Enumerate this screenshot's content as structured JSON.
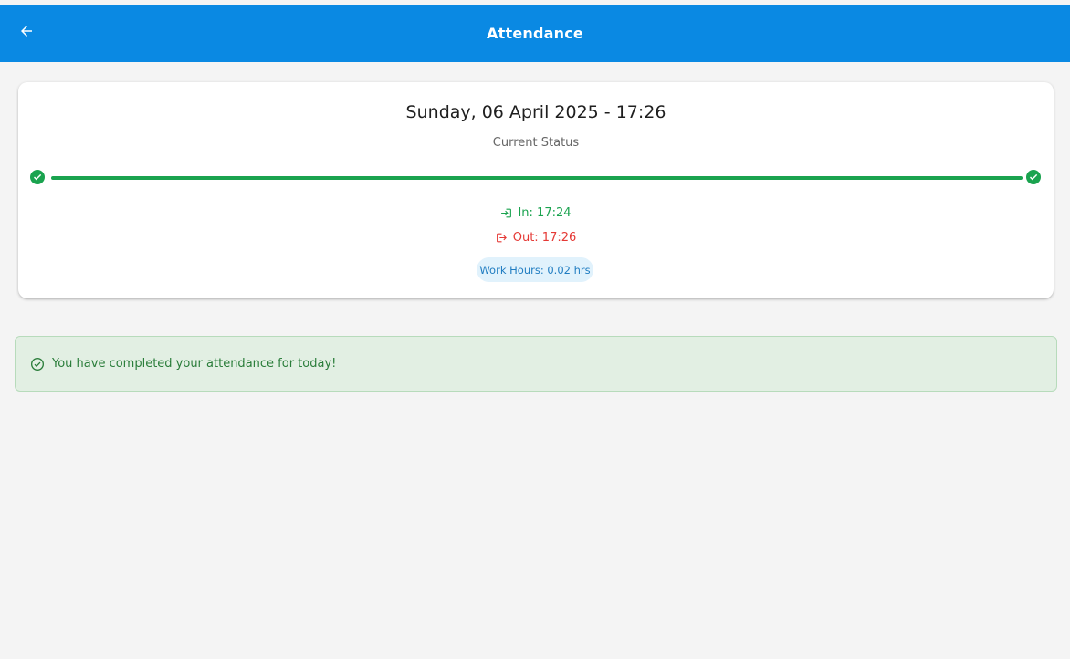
{
  "appbar": {
    "title": "Attendance",
    "back_icon": "arrow-left-icon",
    "color": "#0a89e3"
  },
  "card": {
    "datetime": "Sunday, 06 April 2025 - 17:26",
    "status_label": "Current Status",
    "progress": 1.0,
    "check_in": {
      "icon": "login-icon",
      "label": "In: 17:24",
      "color": "#1aa34f"
    },
    "check_out": {
      "icon": "logout-icon",
      "label": "Out: 17:26",
      "color": "#e53935"
    },
    "work_hours": "Work Hours: 0.02 hrs"
  },
  "alert": {
    "icon": "check-circle-icon",
    "message": "You have completed your attendance for today!"
  }
}
